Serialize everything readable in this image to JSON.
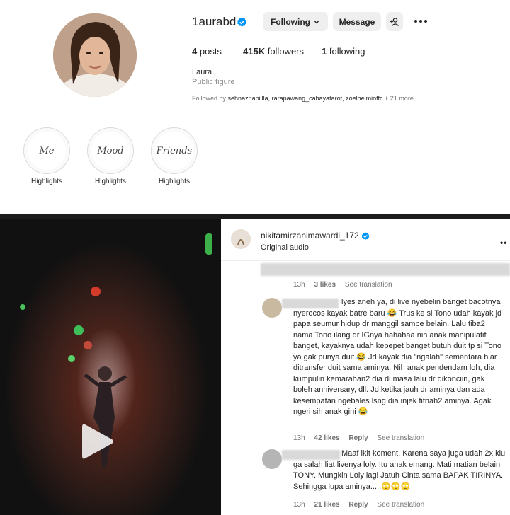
{
  "profile": {
    "username": "1aurabd",
    "following_label": "Following",
    "message_label": "Message",
    "stats": {
      "posts_count": "4",
      "posts_label": "posts",
      "followers_count": "415K",
      "followers_label": "followers",
      "following_count": "1",
      "following_label": "following"
    },
    "name": "Laura",
    "category": "Public figure",
    "followed_by_prefix": "Followed by",
    "followed_by_names": "sehnaznabillla, rarapawang_cahayatarot, zoelhelmioffc",
    "followed_by_more": "+ 21 more",
    "highlights": [
      {
        "cover_text": "Me",
        "label": "Highlights"
      },
      {
        "cover_text": "Mood",
        "label": "Highlights"
      },
      {
        "cover_text": "Friends",
        "label": "Highlights"
      }
    ]
  },
  "post": {
    "author": "nikitamirzanimawardi_172",
    "audio": "Original audio",
    "comments": [
      {
        "text": "",
        "time": "13h",
        "likes": "3 likes",
        "translate": "See translation"
      },
      {
        "text": "lyes aneh ya, di live nyebelin banget bacotnya nyerocos kayak batre baru 😂 Trus ke si Tono udah kayak jd papa seumur hidup dr manggil sampe belain. Lalu tiba2 nama Tono ilang dr IGnya hahahaa nih anak manipulatif banget, kayaknya udah kepepet banget butuh duit tp si Tono ya gak punya duit 😂 Jd kayak dia \"ngalah\" sementara biar ditransfer duit sama aminya. Nih anak pendendam loh, dia kumpulin kemarahan2 dia di masa lalu dr dikonciin, gak boleh anniversary, dll. Jd ketika jauh dr aminya dan ada kesempatan ngebales lsng dia injek fitnah2 aminya. Agak ngeri sih anak gini 😂",
        "time": "13h",
        "likes": "42 likes",
        "reply": "Reply",
        "translate": "See translation"
      },
      {
        "text": "Maaf ikit koment. Karena saya juga udah 2x klu ga salah liat livenya loly. Itu anak emang. Mati matian belain TONY. Mungkin Loly lagi Jatuh Cinta sama BAPAK TIRINYA. Sehingga lupa aminya.....🙄🙄🙄",
        "time": "13h",
        "likes": "21 likes",
        "reply": "Reply",
        "translate": "See translation"
      }
    ]
  },
  "colors": {
    "verified_blue": "#0095f6",
    "button_grey": "#efefef",
    "muted_text": "#737373"
  }
}
